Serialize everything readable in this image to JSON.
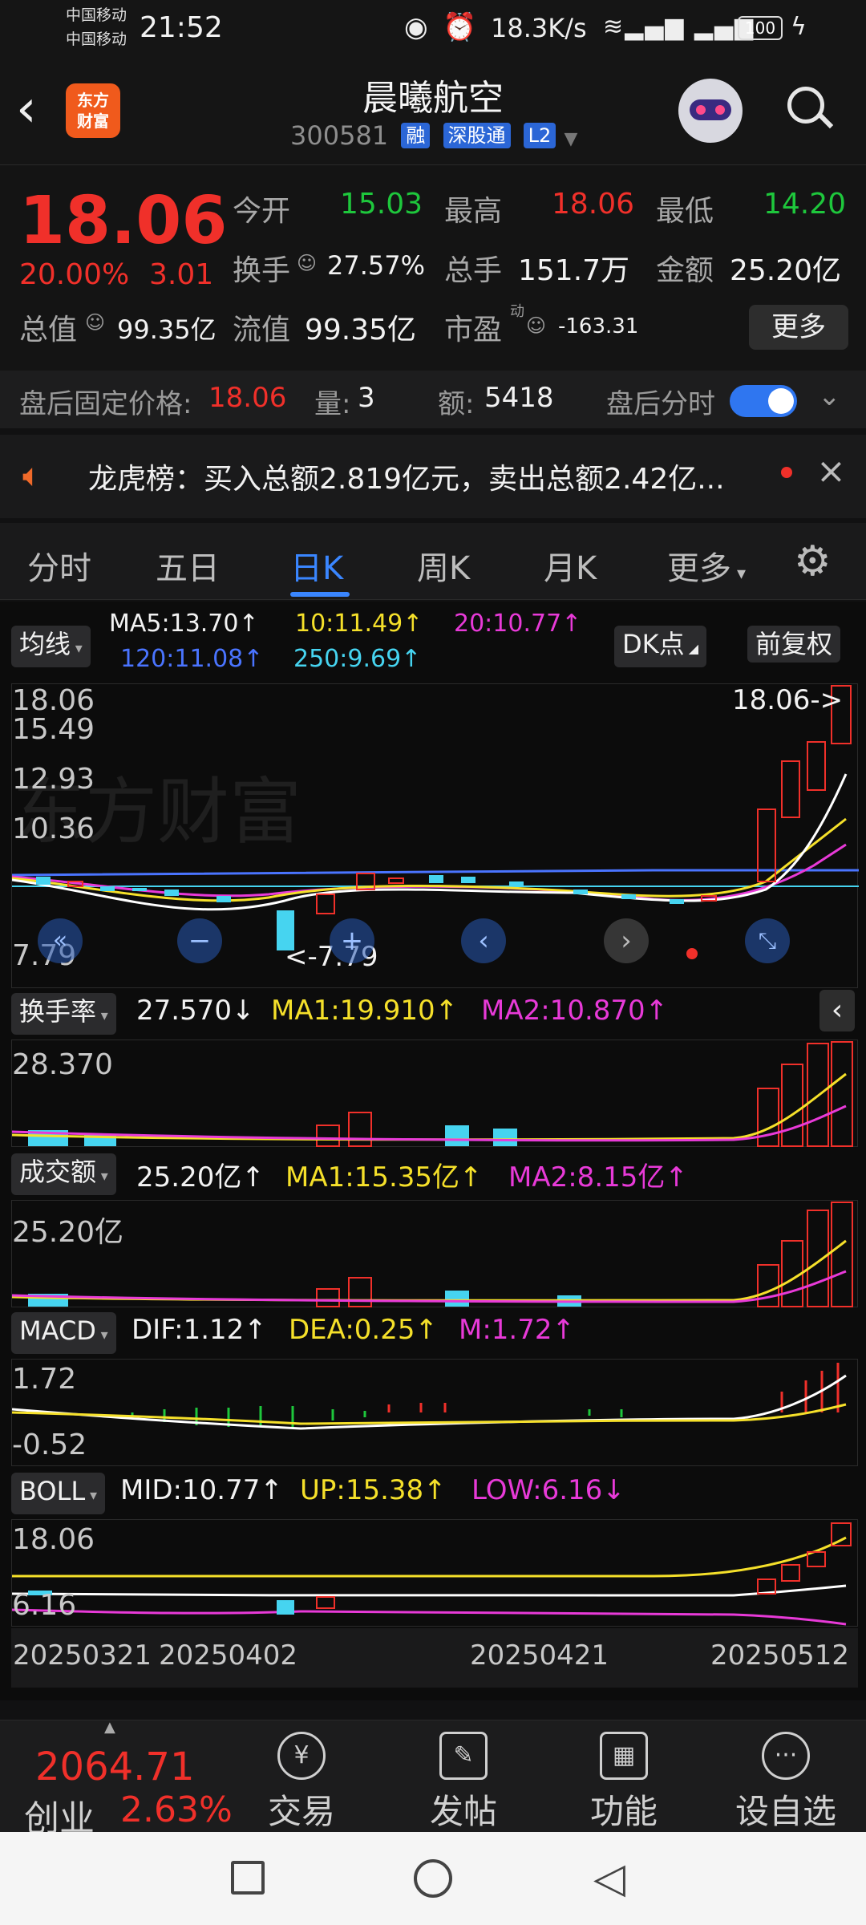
{
  "status": {
    "carrier1": "中国移动",
    "carrier2": "中国移动",
    "time": "21:52",
    "netspeed": "18.3K/s",
    "battery": "100"
  },
  "header": {
    "logo_line1": "东方",
    "logo_line2": "财富",
    "title": "晨曦航空",
    "code": "300581",
    "tags": [
      "融",
      "深股通",
      "L2"
    ]
  },
  "quote": {
    "price": "18.06",
    "change_pct": "20.00%",
    "change_abs": "3.01",
    "open_label": "今开",
    "open": "15.03",
    "high_label": "最高",
    "high": "18.06",
    "low_label": "最低",
    "low": "14.20",
    "turnover_label": "换手",
    "turnover": "27.57%",
    "volume_label": "总手",
    "volume": "151.7万",
    "amount_label": "金额",
    "amount": "25.20亿",
    "mcap_label": "总值",
    "mcap": "99.35亿",
    "float_label": "流值",
    "float": "99.35亿",
    "pe_label": "市盈",
    "pe_sup": "动",
    "pe": "-163.31",
    "more": "更多",
    "after_price_label": "盘后固定价格:",
    "after_price": "18.06",
    "after_vol_label": "量:",
    "after_vol": "3",
    "after_amt_label": "额:",
    "after_amt": "5418",
    "after_toggle_label": "盘后分时"
  },
  "ticker": {
    "text": "龙虎榜：买入总额2.819亿元，卖出总额2.42亿..."
  },
  "tabs": {
    "items": [
      "分时",
      "五日",
      "日K",
      "周K",
      "月K",
      "更多"
    ],
    "active": "日K"
  },
  "chart": {
    "ma_btn": "均线",
    "ma5": "MA5:13.70↑",
    "ma10": "10:11.49↑",
    "ma20": "20:10.77↑",
    "ma120": "120:11.08↑",
    "ma250": "250:9.69↑",
    "dk_btn": "DK点",
    "adj_btn": "前复权",
    "k_axis": [
      "18.06",
      "15.49",
      "12.93",
      "10.36",
      "7.79"
    ],
    "k_last": "18.06->",
    "k_low_mark": "<-7.79",
    "turnover_btn": "换手率",
    "turnover_val": "27.570↓",
    "turnover_ma1": "MA1:19.910↑",
    "turnover_ma2": "MA2:10.870↑",
    "turnover_axis": "28.370",
    "vol_btn": "成交额",
    "vol_val": "25.20亿↑",
    "vol_ma1": "MA1:15.35亿↑",
    "vol_ma2": "MA2:8.15亿↑",
    "vol_axis": "25.20亿",
    "macd_btn": "MACD",
    "macd_dif": "DIF:1.12↑",
    "macd_dea": "DEA:0.25↑",
    "macd_m": "M:1.72↑",
    "macd_axis_top": "1.72",
    "macd_axis_bot": "-0.52",
    "boll_btn": "BOLL",
    "boll_mid": "MID:10.77↑",
    "boll_up": "UP:15.38↑",
    "boll_low": "LOW:6.16↓",
    "boll_axis_top": "18.06",
    "boll_axis_bot": "6.16",
    "dates": [
      "20250321",
      "20250402",
      "20250421",
      "20250512"
    ]
  },
  "chart_data": {
    "type": "candlestick",
    "price_axis_range": [
      7.79,
      18.06
    ],
    "last_price": 18.06,
    "low_price": 7.79,
    "x_dates": [
      "20250321",
      "20250402",
      "20250421",
      "20250512"
    ],
    "ma": {
      "MA5": 13.7,
      "MA10": 11.49,
      "MA20": 10.77,
      "MA120": 11.08,
      "MA250": 9.69
    },
    "turnover": {
      "value": 27.57,
      "MA1": 19.91,
      "MA2": 10.87
    },
    "amount": {
      "value": "25.20亿",
      "MA1": "15.35亿",
      "MA2": "8.15亿"
    },
    "macd": {
      "DIF": 1.12,
      "DEA": 0.25,
      "M": 1.72
    },
    "boll": {
      "MID": 10.77,
      "UP": 15.38,
      "LOW": 6.16
    }
  },
  "bottomnav": {
    "index_value": "2064.71",
    "index_name": "创业",
    "index_pct": "2.63%",
    "items": [
      "交易",
      "发帖",
      "功能",
      "设自选"
    ]
  },
  "colors": {
    "up": "#f0302a",
    "down": "#1ec73c",
    "accent": "#3a86ff",
    "ma5": "#ffffff",
    "ma10": "#f5e02a",
    "ma20": "#e83ad8",
    "ma120": "#4a74ff",
    "ma250": "#46d4f0"
  }
}
